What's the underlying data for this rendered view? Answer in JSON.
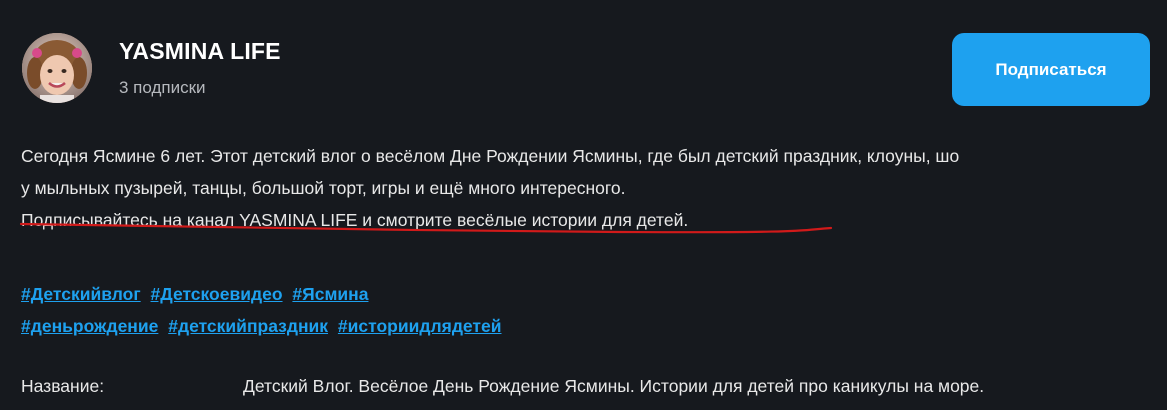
{
  "channel": {
    "name": "YASMINA LIFE",
    "subscriptions": "3 подписки",
    "subscribe_label": "Подписаться"
  },
  "description": {
    "lines": [
      "Сегодня Ясмине 6 лет. Этот детский влог о весёлом Дне Рождении Ясмины, где был детский праздник, клоуны, шо",
      "у мыльных пузырей, танцы, большой торт, игры и ещё много интересного.",
      "Подписывайтесь на канал YASMINA LIFE и смотрите весёлые истории для детей."
    ]
  },
  "hashtags": {
    "row1": [
      "#Детскийвлог",
      "#Детскоевидео",
      "#Ясмина"
    ],
    "row2": [
      "#деньрождение",
      "#детскийпраздник",
      "#историидлядетей"
    ]
  },
  "meta": {
    "title_label": "Название:",
    "title_value": "Детский Влог. Весёлое День Рождение Ясмины. Истории для детей про каникулы на море."
  },
  "colors": {
    "background": "#16191e",
    "accent": "#1ea1ef",
    "annotation_underline": "#d11a1a"
  },
  "icons": {
    "avatar": "channel-avatar-photo"
  }
}
